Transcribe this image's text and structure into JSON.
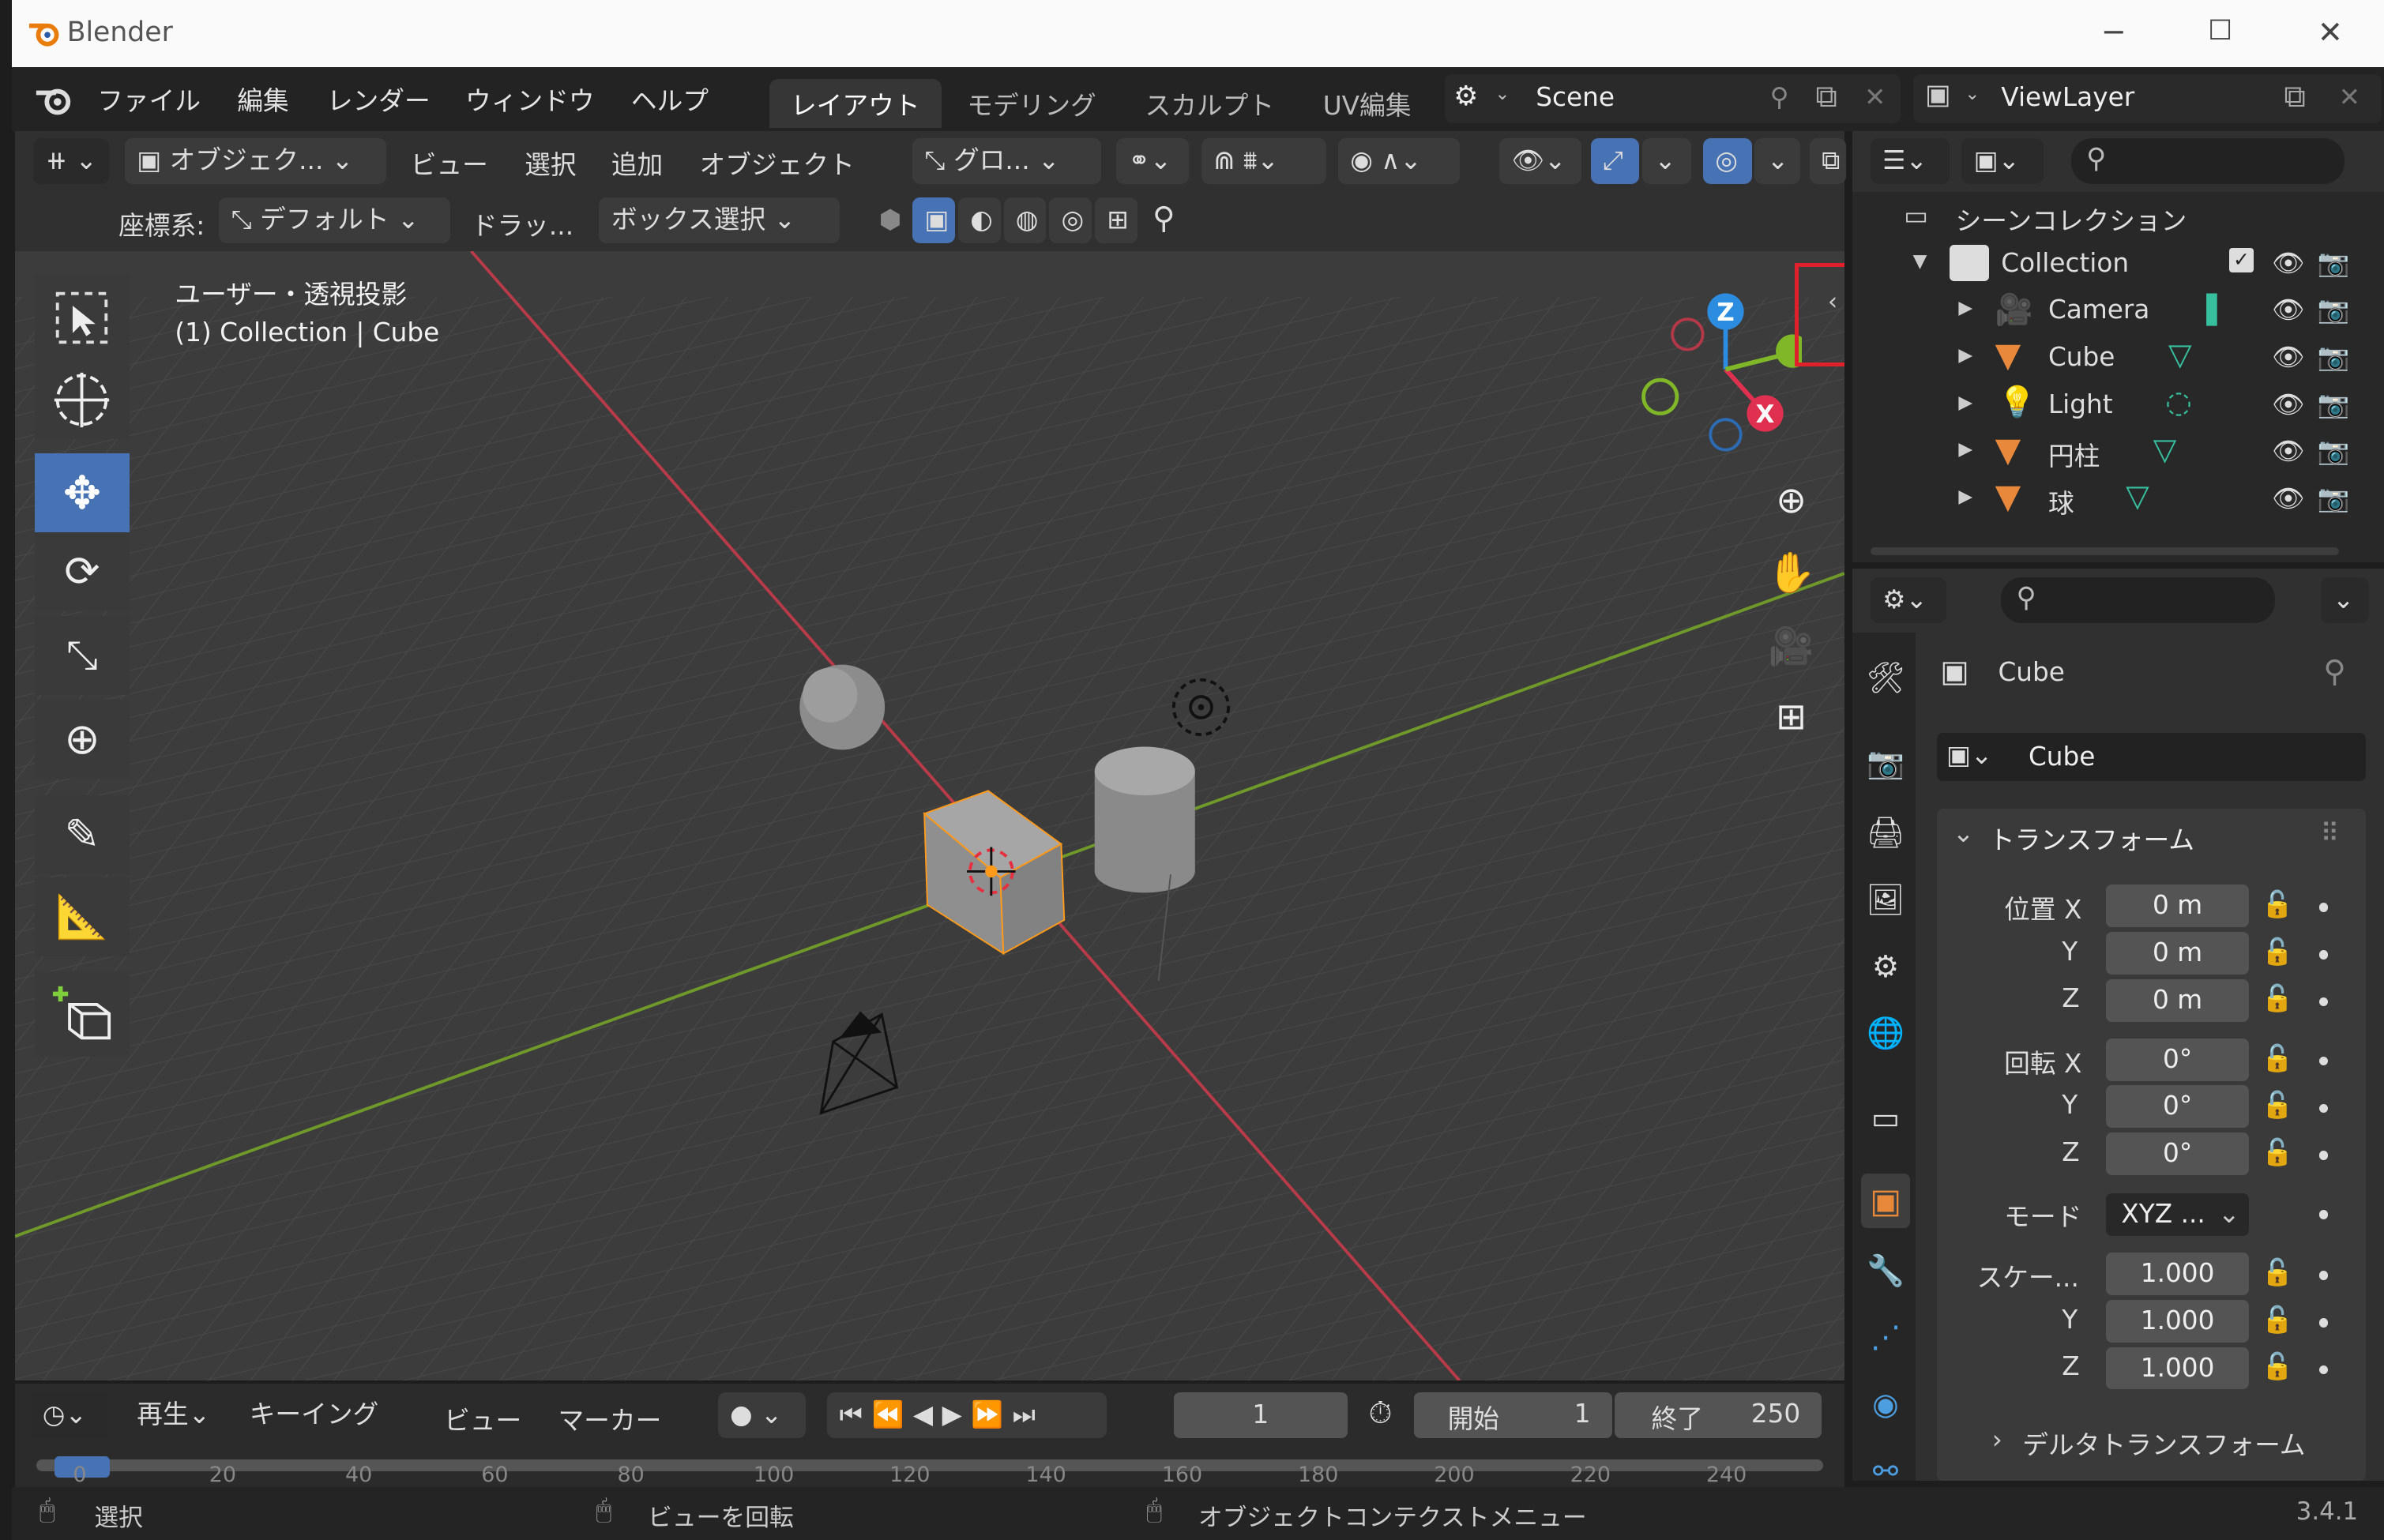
{
  "window": {
    "title": "Blender",
    "minimize": "─",
    "maximize": "☐",
    "close": "✕"
  },
  "menu": {
    "items": [
      "ファイル",
      "編集",
      "レンダー",
      "ウィンドウ",
      "ヘルプ"
    ]
  },
  "workspaces": [
    "レイアウト",
    "モデリング",
    "スカルプト",
    "UV編集"
  ],
  "scene": {
    "name": "Scene"
  },
  "viewlayer": {
    "name": "ViewLayer"
  },
  "viewport_header": {
    "mode": "オブジェク...",
    "view": "ビュー",
    "select": "選択",
    "add": "追加",
    "object": "オブジェクト",
    "transform": "グロ...",
    "coord_label": "座標系:",
    "coord_value": "デフォルト",
    "drag": "ドラッ...",
    "box_select": "ボックス選択"
  },
  "viewport": {
    "line1": "ユーザー・透視投影",
    "line2": "(1) Collection | Cube",
    "axis_x": "X",
    "axis_z": "Z"
  },
  "outliner": {
    "root": "シーンコレクション",
    "collection": "Collection",
    "items": [
      "Camera",
      "Cube",
      "Light",
      "円柱",
      "球"
    ]
  },
  "properties": {
    "object_name": "Cube",
    "data_name": "Cube",
    "section": "トランスフォーム",
    "loc_label": "位置 X",
    "rot_label": "回転 X",
    "mode_label": "モード",
    "scale_label": "スケー...",
    "y": "Y",
    "z": "Z",
    "loc": [
      "0 m",
      "0 m",
      "0 m"
    ],
    "rot": [
      "0°",
      "0°",
      "0°"
    ],
    "mode": "XYZ ...",
    "scale": [
      "1.000",
      "1.000",
      "1.000"
    ],
    "delta": "デルタトランスフォーム"
  },
  "timeline": {
    "play": "再生",
    "keying": "キーイング",
    "view": "ビュー",
    "marker": "マーカー",
    "frame": "1",
    "start_label": "開始",
    "start": "1",
    "end_label": "終了",
    "end": "250",
    "ticks": [
      "0",
      "20",
      "40",
      "60",
      "80",
      "100",
      "120",
      "140",
      "160",
      "180",
      "200",
      "220",
      "240"
    ]
  },
  "status": {
    "select": "選択",
    "rotate": "ビューを回転",
    "context": "オブジェクトコンテクストメニュー",
    "version": "3.4.1"
  },
  "colors": {
    "accent": "#4772b3",
    "axis_x": "#e0304f",
    "axis_y": "#7fb728",
    "axis_z": "#2c8ce0",
    "object_orange": "#e8883a",
    "highlight": "#e0202a"
  }
}
